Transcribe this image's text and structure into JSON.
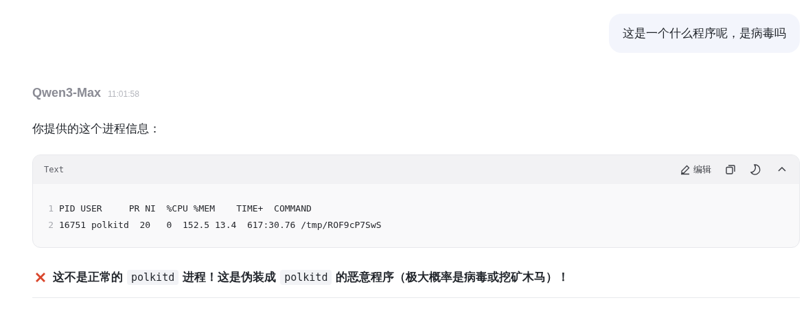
{
  "user_message": {
    "text": "这是一个什么程序呢，是病毒吗"
  },
  "assistant": {
    "name": "Qwen3-Max",
    "time": "11:01:58"
  },
  "intro": "你提供的这个进程信息：",
  "code_block": {
    "language": "Text",
    "edit_label": "编辑",
    "collapsed": false,
    "lines": [
      {
        "number": "1",
        "text": "PID USER     PR NI  %CPU %MEM    TIME+  COMMAND"
      },
      {
        "number": "2",
        "text": "16751 polkitd  20   0  152.5 13.4  617:30.76 /tmp/ROF9cP7SwS"
      }
    ]
  },
  "warning": {
    "segments": [
      {
        "kind": "text",
        "text": "这不是正常的"
      },
      {
        "kind": "code",
        "text": "polkitd"
      },
      {
        "kind": "text",
        "text": "进程！这是伪装成"
      },
      {
        "kind": "code",
        "text": "polkitd"
      },
      {
        "kind": "text",
        "text": "的恶意程序（极大概率是病毒或挖矿木马）！"
      }
    ]
  }
}
